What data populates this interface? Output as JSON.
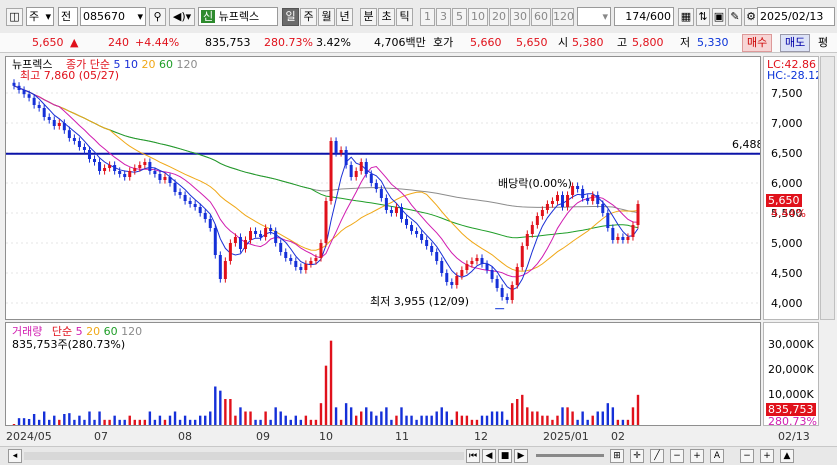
{
  "toolbar": {
    "market": "주",
    "type": "전",
    "code": "085670",
    "badge": "신",
    "name": "뉴프렉스",
    "periods": [
      "일",
      "주",
      "월",
      "년",
      "분",
      "초",
      "틱"
    ],
    "active_period": "일",
    "intervals": [
      "1",
      "3",
      "5",
      "10",
      "20",
      "30",
      "60",
      "120"
    ],
    "count": "174",
    "total": "/600",
    "date": "2025/02/13"
  },
  "quote": {
    "price": "5,650",
    "change": "240",
    "change_pct": "+4.44%",
    "volume": "835,753",
    "vol_ratio": "280.73%",
    "turnover": "3.42%",
    "amount": "4,706백만",
    "bid_label": "호가",
    "ask": "5,660",
    "bid": "5,650",
    "open_label": "시",
    "open": "5,380",
    "high_label": "고",
    "high": "5,800",
    "low_label": "저",
    "low": "5,330",
    "buy": "매수",
    "sell": "매도",
    "avg": "평"
  },
  "colors": {
    "up": "#e0111b",
    "down": "#1530d8",
    "ma5": "#1a2fd6",
    "ma10": "#d01cb0",
    "ma20": "#f0a818",
    "ma60": "#1f9e28",
    "ma120": "#8c8c8c"
  },
  "price_panel": {
    "title": "뉴프렉스",
    "ma_label": "종가 단순",
    "ma_periods": [
      "5",
      "10",
      "20",
      "60",
      "120"
    ],
    "high_note": "최고 7,860 (05/27)",
    "low_note": "최저 3,955 (12/09)",
    "dividend_note": "배당락(0.00%)",
    "hline_label": "6,488",
    "lc": "LC:42.86",
    "hc": "HC:-28.12",
    "y_ticks": [
      "7,500",
      "7,000",
      "6,500",
      "6,000",
      "5,500",
      "5,000",
      "4,500",
      "4,000"
    ],
    "price_tag": "5,650",
    "pct_tag": "4.44%"
  },
  "volume_panel": {
    "title": "거래량",
    "ma_label": "단순",
    "ma_periods": [
      "5",
      "20",
      "60",
      "120"
    ],
    "value_note": "835,753주(280.73%)",
    "y_ticks": [
      "30,000K",
      "20,000K",
      "10,000K"
    ],
    "vol_tag": "835,753",
    "ratio_tag": "280.73%"
  },
  "x_axis": {
    "labels": [
      "2024/05",
      "07",
      "08",
      "09",
      "10",
      "11",
      "12",
      "2025/01",
      "02"
    ],
    "cursor_date": "02/13"
  },
  "chart_data": {
    "type": "candlestick",
    "y_range": [
      3800,
      8000
    ],
    "hline": 6488,
    "high": {
      "date": "05/27",
      "price": 7860
    },
    "low": {
      "date": "12/09",
      "price": 3955
    },
    "last_close": 5650,
    "closes": [
      7620,
      7550,
      7480,
      7420,
      7300,
      7250,
      7100,
      7050,
      6950,
      7000,
      6880,
      6750,
      6700,
      6600,
      6550,
      6400,
      6350,
      6200,
      6250,
      6300,
      6200,
      6150,
      6100,
      6200,
      6250,
      6300,
      6350,
      6200,
      6150,
      6050,
      6100,
      6000,
      5850,
      5800,
      5700,
      5650,
      5600,
      5500,
      5400,
      5250,
      4800,
      4400,
      4700,
      5000,
      5100,
      4900,
      5050,
      5200,
      5150,
      5100,
      5250,
      5200,
      5000,
      4850,
      4750,
      4700,
      4600,
      4550,
      4650,
      4700,
      4750,
      5000,
      5700,
      6700,
      6500,
      6550,
      6300,
      6100,
      6200,
      6350,
      6150,
      6000,
      5900,
      5750,
      5550,
      5500,
      5600,
      5400,
      5300,
      5200,
      5150,
      5050,
      4950,
      4850,
      4700,
      4500,
      4350,
      4300,
      4450,
      4550,
      4650,
      4700,
      4750,
      4650,
      4550,
      4400,
      4250,
      4100,
      4050,
      4300,
      4600,
      4950,
      5150,
      5300,
      5450,
      5550,
      5650,
      5700,
      5800,
      5600,
      5800,
      5950,
      5900,
      5750,
      5700,
      5800,
      5650,
      5500,
      5250,
      5050,
      5100,
      5050,
      5100,
      5300,
      5650
    ]
  }
}
